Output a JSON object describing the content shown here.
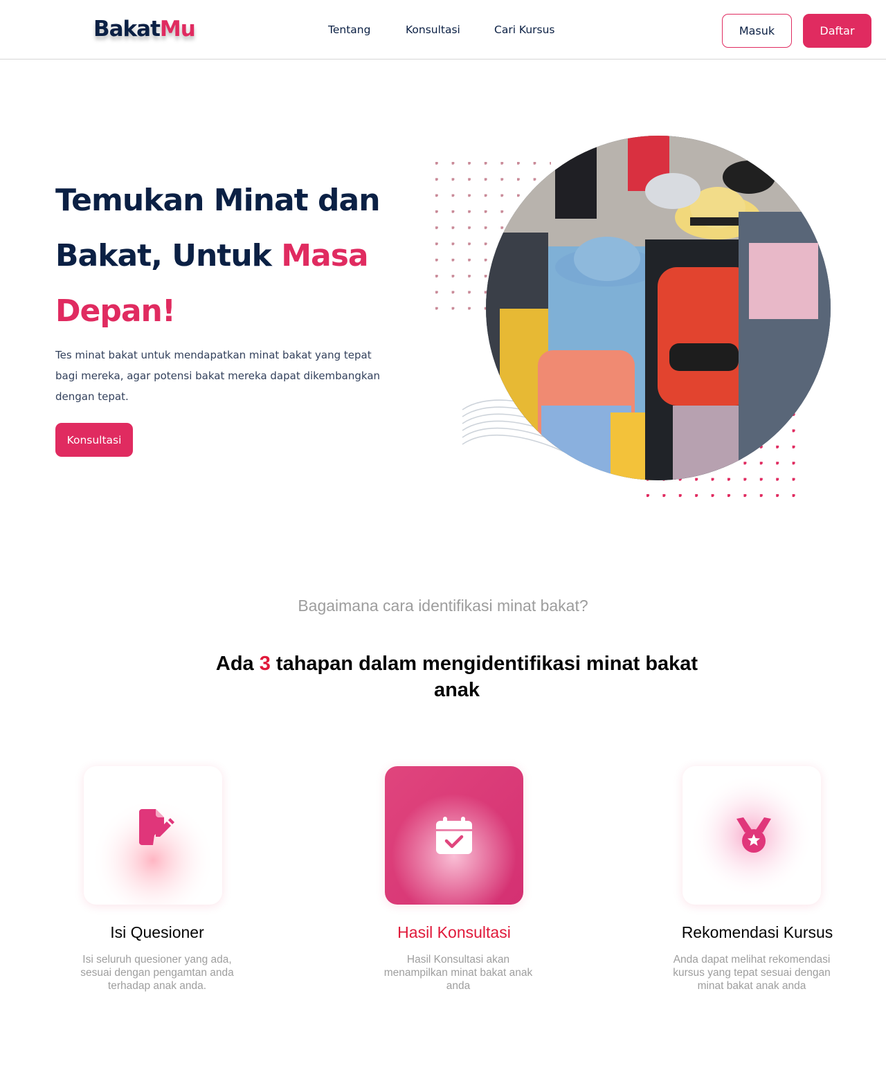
{
  "header": {
    "logo_part1": "Bakat",
    "logo_part2": "Mu",
    "nav": [
      "Tentang",
      "Konsultasi",
      "Cari Kursus"
    ],
    "login_label": "Masuk",
    "register_label": "Daftar"
  },
  "hero": {
    "title_line1": "Temukan Minat dan",
    "title_line2_a": "Bakat, Untuk ",
    "title_line2_b": "Masa",
    "title_line3": "Depan!",
    "description": "Tes minat bakat untuk mendapatkan minat bakat yang tepat bagi mereka, agar potensi bakat mereka dapat dikembangkan dengan tepat.",
    "cta_label": "Konsultasi"
  },
  "steps_section": {
    "subtitle": "Bagaimana cara identifikasi minat bakat?",
    "heading_before": "Ada ",
    "heading_number": "3",
    "heading_after": " tahapan dalam mengidentifikasi minat bakat anak",
    "steps": [
      {
        "icon": "file-edit-icon",
        "title": "Isi Quesioner",
        "description": "Isi seluruh quesioner yang ada, sesuai dengan pengamtan anda terhadap anak anda."
      },
      {
        "icon": "calendar-check-icon",
        "title": "Hasil Konsultasi",
        "description": "Hasil Konsultasi akan menampilkan minat bakat anak anda"
      },
      {
        "icon": "medal-icon",
        "title": "Rekomendasi Kursus",
        "description": "Anda dapat melihat rekomendasi kursus yang tepat sesuai dengan minat bakat anak anda"
      }
    ]
  },
  "colors": {
    "brand_pink": "#e02b60",
    "navy": "#0b2044",
    "accent_red": "#e0193a"
  }
}
